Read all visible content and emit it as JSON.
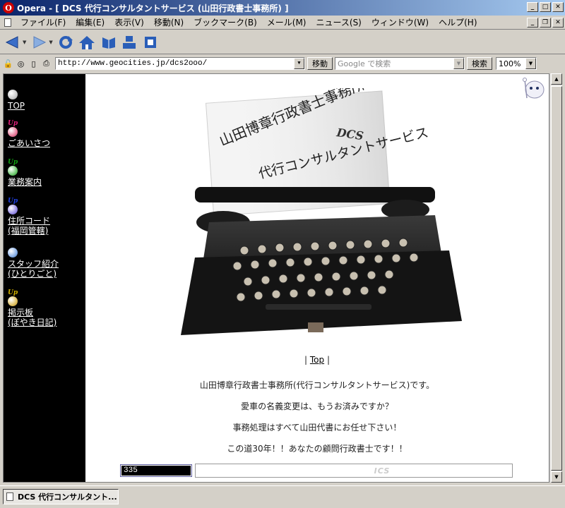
{
  "window": {
    "app_icon_letter": "O",
    "title": "Opera - [ DCS 代行コンサルタントサービス (山田行政書士事務所) ]"
  },
  "menu": [
    "ファイル(F)",
    "編集(E)",
    "表示(V)",
    "移動(N)",
    "ブックマーク(B)",
    "メール(M)",
    "ニュース(S)",
    "ウィンドウ(W)",
    "ヘルプ(H)"
  ],
  "address_bar": {
    "url": "http://www.geocities.jp/dcs2ooo/",
    "go_button": "移動",
    "search_placeholder": "Google で検索",
    "search_button": "検索",
    "zoom": "100%"
  },
  "sidebar": {
    "items": [
      {
        "label": "TOP",
        "ball_color": "#c8c8c8",
        "up": false
      },
      {
        "label": "ごあいさつ",
        "ball_color": "#e87a9a",
        "up": true,
        "up_color": "#c00070"
      },
      {
        "label": "業務案内",
        "ball_color": "#6ec86e",
        "up": true,
        "up_color": "#007000"
      },
      {
        "label": "住所コード",
        "label2": "(福岡管轄)",
        "ball_color": "#9a8ee8",
        "up": true,
        "up_color": "#0000c0"
      },
      {
        "label": "スタッフ紹介",
        "label2": "(ひとりごと)",
        "ball_color": "#8ab0e8",
        "up": false
      },
      {
        "label": "掲示板",
        "label2": "(ぼやき日記)",
        "ball_color": "#e0c060",
        "up": true,
        "up_color": "#c0a000"
      }
    ],
    "up_text": "Up"
  },
  "hero": {
    "paper_line1": "山田博章行政書士事務所",
    "paper_logo": "DCS",
    "paper_line2": "代行コンサルタントサービス"
  },
  "content": {
    "nav_prefix": "|",
    "nav_link": "Top",
    "nav_suffix": "|",
    "line1": "山田博章行政書士事務所(代行コンサルタントサービス)です。",
    "line2": "愛車の名義変更は、もうお済みですか？",
    "line3": "事務処理はすべて山田代書にお任せ下さい！",
    "line4": "この道30年！！あなたの顧問行政書士です！！"
  },
  "counter": "335",
  "banner_text": "ICS",
  "taskbar": {
    "task_label": "DCS 代行コンサルタント..."
  }
}
